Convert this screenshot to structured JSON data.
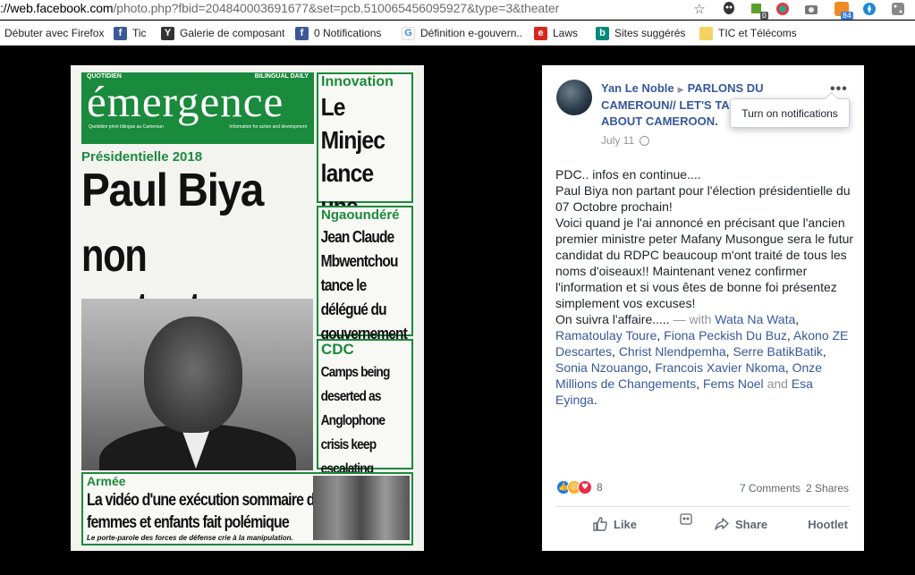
{
  "browser": {
    "url_host": "://web.facebook.com",
    "url_rest": "/photo.php?fbid=204840003691677&set=pcb.510065456095927&type=3&theater",
    "badges": {
      "ext1": "0",
      "rss": "84"
    }
  },
  "bookmarks": [
    {
      "label": "Débuter avec Firefox",
      "icon": "firefox-icon"
    },
    {
      "label": "Tic",
      "icon": "facebook-icon"
    },
    {
      "label": "Galerie de composants...",
      "icon": "gallery-icon"
    },
    {
      "label": "0 Notifications",
      "icon": "facebook-icon"
    },
    {
      "label": "Définition e-gouvern...",
      "icon": "google-icon"
    },
    {
      "label": "Laws",
      "icon": "laws-icon"
    },
    {
      "label": "Sites suggérés",
      "icon": "bing-icon"
    },
    {
      "label": "TIC et Télécoms",
      "icon": "folder-icon"
    }
  ],
  "newspaper": {
    "quotidien": "QUOTIDIEN",
    "bilingual": "BILINGUAL DAILY",
    "masthead": "émergence",
    "tag_left": "Quotidien privé bilingue au Cameroun",
    "tag_right": "Information for action and development",
    "section": "Présidentielle 2018",
    "headline_1": "Paul Biya",
    "headline_2": "non partant",
    "box1_kicker": "Innovation",
    "box1_text": "Le Minjec lance une Web Tv",
    "box2_kicker": "Ngaoundéré",
    "box2_text": "Jean Claude Mbwentchou tance le délégué du gouvernement",
    "box3_kicker": "CDC",
    "box3_text": "Camps being deserted as Anglophone crisis keep escalating",
    "armee_kicker": "Armée",
    "armee_text": "La vidéo d'une exécution sommaire de femmes et enfants fait polémique",
    "armee_sub": "Le porte-parole des forces de défense crie à la manipulation."
  },
  "post": {
    "author": "Yan Le Noble",
    "group": "PARLONS DU CAMEROUN// LET'S TALK ABOUT CAMEROON.",
    "date": "July 11",
    "tooltip": "Turn on notifications",
    "text_lines": [
      "PDC.. infos en continue....",
      "Paul Biya non partant pour l'élection présidentielle du 07 Octobre prochain!",
      "Voici quand je l'ai annoncé en précisant que l'ancien premier ministre peter Mafany Musongue sera le futur candidat du RDPC beaucoup m'ont traité de tous les noms d'oiseaux!! Maintenant venez confirmer l'information et si vous êtes de bonne foi présentez simplement vos excuses!"
    ],
    "follow_text": "On suivra l'affaire.....",
    "with_text": "— with",
    "tagged": [
      "Wata Na Wata",
      "Ramatoulay Toure",
      "Fiona Peckish Du Buz",
      "Akono ZE Descartes",
      "Christ Nlendpemha",
      "Serre BatikBatik",
      "Sonia Nzouango",
      "Francois Xavier Nkoma",
      "Onze Millions de Changements",
      "Fems Noel",
      "Esa Eyinga"
    ],
    "and_text": "and",
    "reaction_count": "8",
    "comments": "7 Comments",
    "shares": "2 Shares",
    "actions": {
      "like": "Like",
      "share": "Share",
      "hootlet": "Hootlet"
    }
  },
  "colors": {
    "fb_link": "#365899",
    "brand_green": "#1a8a3c",
    "muted": "#90949c"
  }
}
